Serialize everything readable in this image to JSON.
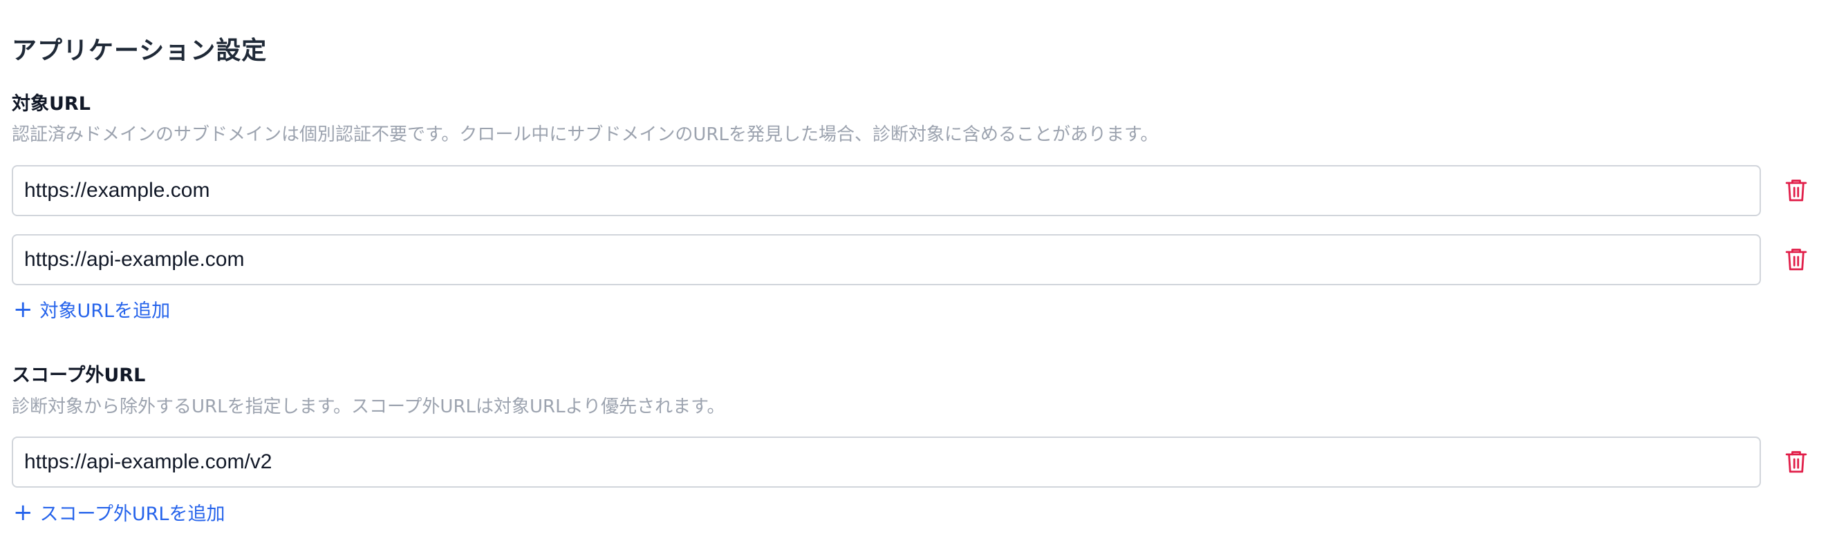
{
  "page": {
    "title": "アプリケーション設定"
  },
  "target_urls": {
    "label": "対象URL",
    "description": "認証済みドメインのサブドメインは個別認証不要です。クロール中にサブドメインのURLを発見した場合、診断対象に含めることがあります。",
    "items": [
      {
        "value": "https://example.com"
      },
      {
        "value": "https://api-example.com"
      }
    ],
    "add_label": "対象URLを追加"
  },
  "out_of_scope_urls": {
    "label": "スコープ外URL",
    "description": "診断対象から除外するURLを指定します。スコープ外URLは対象URLより優先されます。",
    "items": [
      {
        "value": "https://api-example.com/v2"
      }
    ],
    "add_label": "スコープ外URLを追加"
  },
  "icons": {
    "delete": "trash-icon",
    "add": "plus-icon"
  },
  "colors": {
    "delete_icon": "#e11d48",
    "link": "#2563eb",
    "description": "#9ca3af",
    "input_border": "#d1d5db"
  }
}
